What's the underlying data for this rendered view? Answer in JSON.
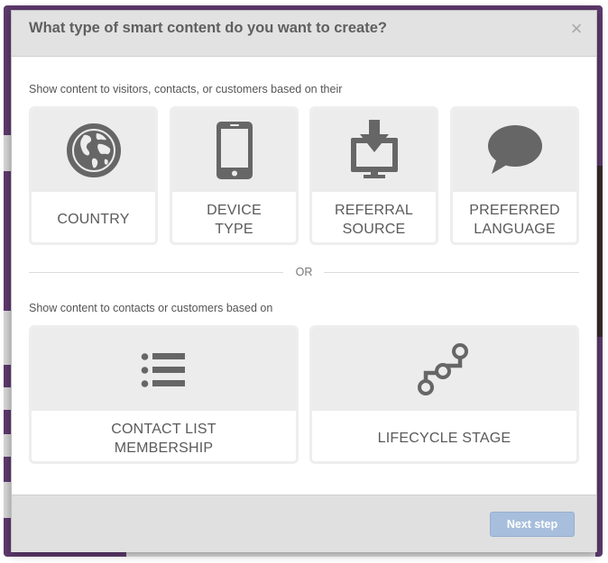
{
  "dialog": {
    "title": "What type of smart content do you want to create?",
    "close_symbol": "×"
  },
  "section_visitors": {
    "label": "Show content to visitors, contacts, or customers based on their",
    "cards": [
      {
        "line1": "COUNTRY",
        "line2": "",
        "icon": "globe-icon"
      },
      {
        "line1": "DEVICE",
        "line2": "TYPE",
        "icon": "mobile-device-icon"
      },
      {
        "line1": "REFERRAL",
        "line2": "SOURCE",
        "icon": "download-monitor-icon"
      },
      {
        "line1": "PREFERRED",
        "line2": "LANGUAGE",
        "icon": "speech-bubble-icon"
      }
    ]
  },
  "divider": {
    "text": "OR"
  },
  "section_contacts": {
    "label": "Show content to contacts or customers based on",
    "cards": [
      {
        "line1": "CONTACT LIST",
        "line2": "MEMBERSHIP",
        "icon": "list-icon"
      },
      {
        "line1": "LIFECYCLE STAGE",
        "line2": "",
        "icon": "lifecycle-stage-icon"
      }
    ]
  },
  "footer": {
    "next_label": "Next step",
    "next_state": "disabled"
  },
  "colors": {
    "header_bg": "#e2e2e2",
    "card_top_bg": "#ececec",
    "icon": "#666666",
    "next_button": "#a7bfdc",
    "background_frame": "#5e3a6e"
  }
}
